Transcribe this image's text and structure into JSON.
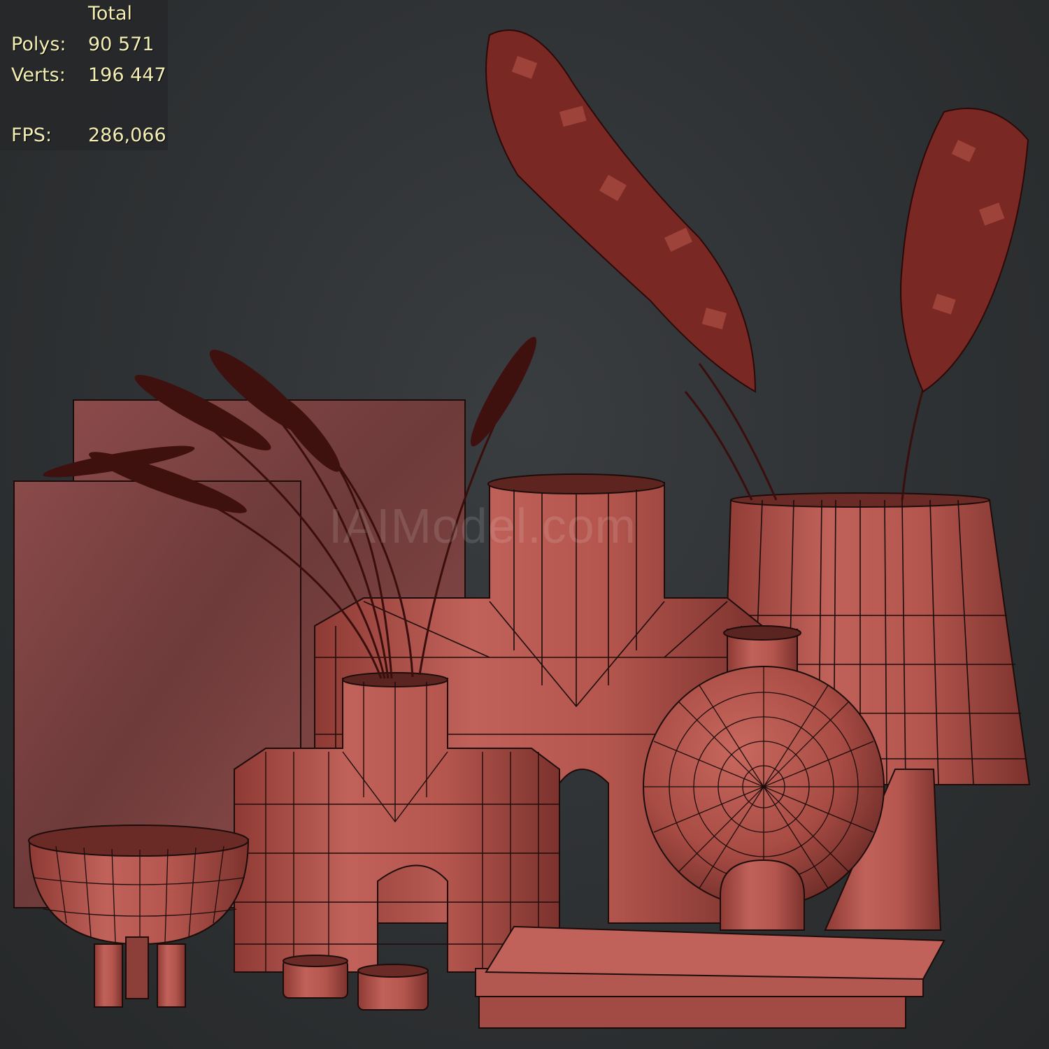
{
  "stats": {
    "header": "Total",
    "rows": [
      {
        "label": "Polys:",
        "value": "90 571"
      },
      {
        "label": "Verts:",
        "value": "196 447"
      },
      {
        "label": "FPS:",
        "value": "286,066"
      }
    ]
  },
  "watermark": "IAIModel.com",
  "colors": {
    "background": "#2e3133",
    "model_base": "#b85a52",
    "model_dark": "#8c3e38",
    "wire": "#1c0c0a",
    "stat_text": "#f4eeb4"
  },
  "icons": [
    "decorative-pampas-grass",
    "vase-models"
  ]
}
